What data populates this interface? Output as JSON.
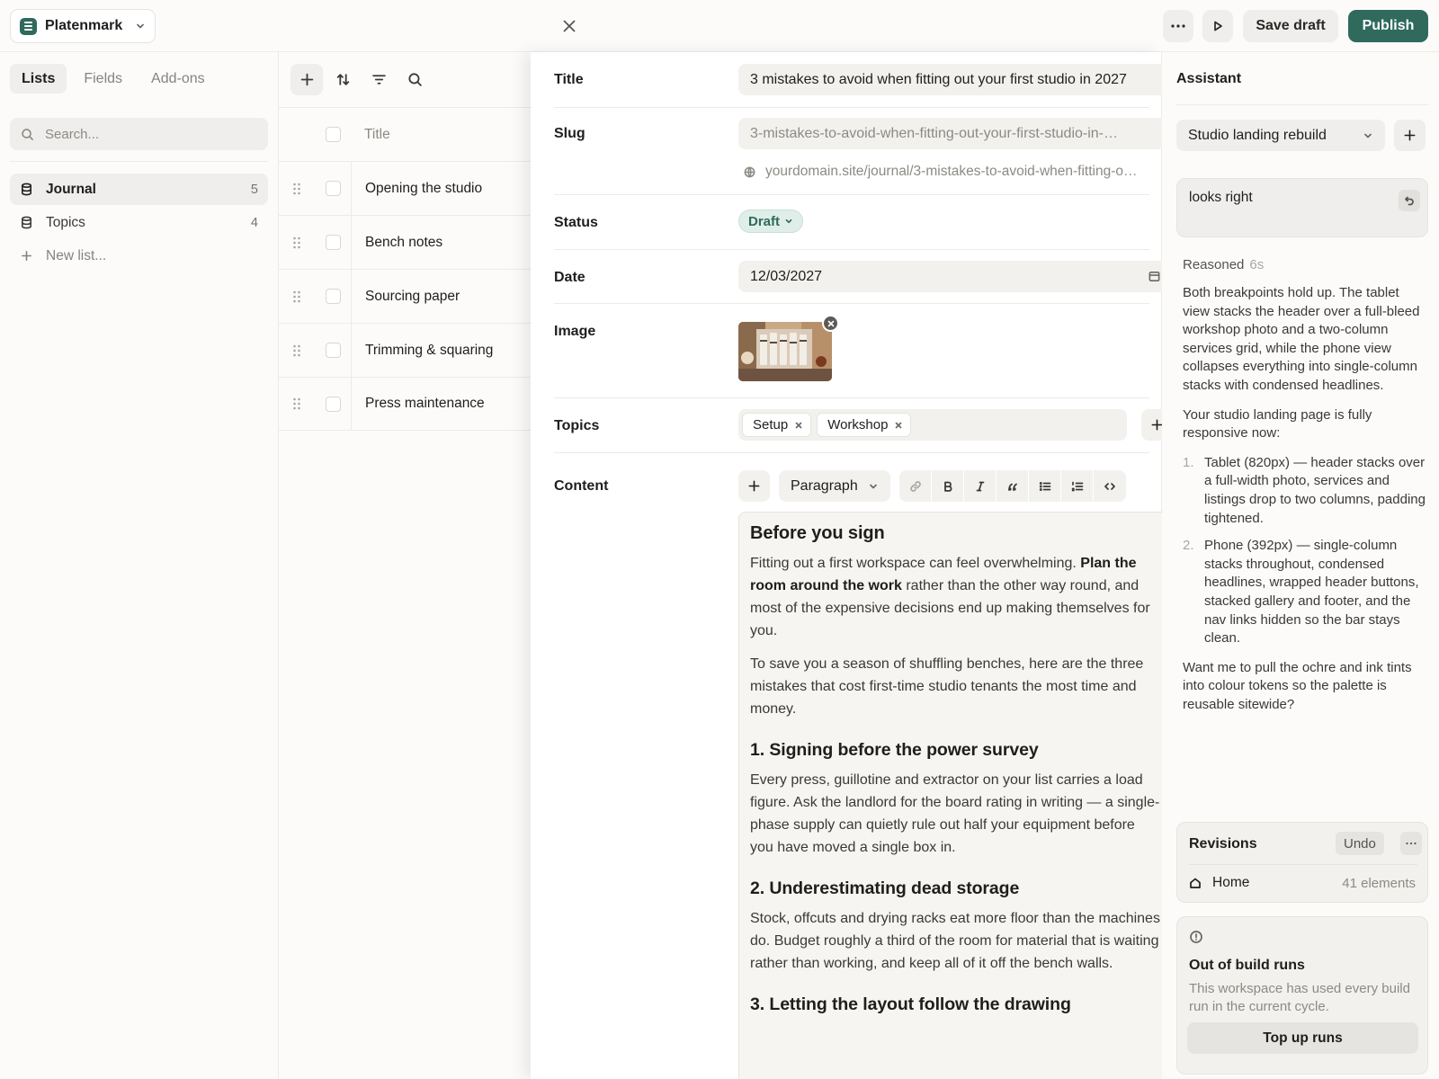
{
  "app": {
    "name": "Platenmark"
  },
  "toolbar": {
    "save_label": "Save draft",
    "publish_label": "Publish"
  },
  "sidebar": {
    "tabs": [
      {
        "label": "Lists"
      },
      {
        "label": "Fields"
      },
      {
        "label": "Add-ons"
      }
    ],
    "search_placeholder": "Search...",
    "items": [
      {
        "label": "Journal",
        "count": "5"
      },
      {
        "label": "Topics",
        "count": "4"
      }
    ],
    "new_list_label": "New list..."
  },
  "list": {
    "header_title": "Title",
    "rows": [
      {
        "title": "Opening the studio"
      },
      {
        "title": "Bench notes"
      },
      {
        "title": "Sourcing paper"
      },
      {
        "title": "Trimming & squaring"
      },
      {
        "title": "Press maintenance"
      }
    ]
  },
  "editor": {
    "title_label": "Title",
    "title_value": "3 mistakes to avoid when fitting out your first studio in 2027",
    "slug_label": "Slug",
    "slug_value": "3-mistakes-to-avoid-when-fitting-out-your-first-studio-in-…",
    "url_value": "yourdomain.site/journal/3-mistakes-to-avoid-when-fitting-o…",
    "status_label": "Status",
    "status_value": "Draft",
    "date_label": "Date",
    "date_value": "12/03/2027",
    "image_label": "Image",
    "topics_label": "Topics",
    "topics": [
      {
        "label": "Setup"
      },
      {
        "label": "Workshop"
      }
    ],
    "content_label": "Content",
    "block_type": "Paragraph",
    "content": {
      "h1": "Before you sign",
      "p1_a": "Fitting out a first workspace can feel overwhelming. ",
      "p1_b": "Plan the room around the work",
      "p1_c": " rather than the other way round, and most of the expensive decisions end up making themselves for you.",
      "p2": "To save you a season of shuffling benches, here are the three mistakes that cost first-time studio tenants the most time and money.",
      "h2": "1. Signing before the power survey",
      "p3": "Every press, guillotine and extractor on your list carries a load figure. Ask the landlord for the board rating in writing — a single-phase supply can quietly rule out half your equipment before you have moved a single box in.",
      "h3": "2. Underestimating dead storage",
      "p4": "Stock, offcuts and drying racks eat more floor than the machines do. Budget roughly a third of the room for material that is waiting rather than working, and keep all of it off the bench walls.",
      "h4": "3. Letting the layout follow the drawing"
    }
  },
  "assistant": {
    "title": "Assistant",
    "project": "Studio landing rebuild",
    "user_message": "looks right",
    "reasoned_label": "Reasoned",
    "reasoned_time": "6s",
    "reply_p1": "Both breakpoints hold up. The tablet view stacks the header over a full-bleed workshop photo and a two-column services grid, while the phone view collapses everything into single-column stacks with condensed headlines.",
    "reply_p2": "Your studio landing page is fully responsive now:",
    "reply_list": [
      {
        "num": "1.",
        "text": "Tablet (820px) — header stacks over a full-width photo, services and listings drop to two columns, padding tightened."
      },
      {
        "num": "2.",
        "text": "Phone (392px) — single-column stacks throughout, condensed headlines, wrapped header buttons, stacked gallery and footer, and the nav links hidden so the bar stays clean."
      }
    ],
    "reply_p3": "Want me to pull the ochre and ink tints into colour tokens so the palette is reusable sitewide?",
    "revisions": {
      "title": "Revisions",
      "undo_label": "Undo",
      "page": "Home",
      "count": "41 elements"
    },
    "runs": {
      "title": "Out of build runs",
      "description": "This workspace has used every build run in the current cycle.",
      "button": "Top up runs"
    }
  },
  "colors": {
    "accent": "#2f6a5c",
    "status_bg": "#dfeee8"
  }
}
